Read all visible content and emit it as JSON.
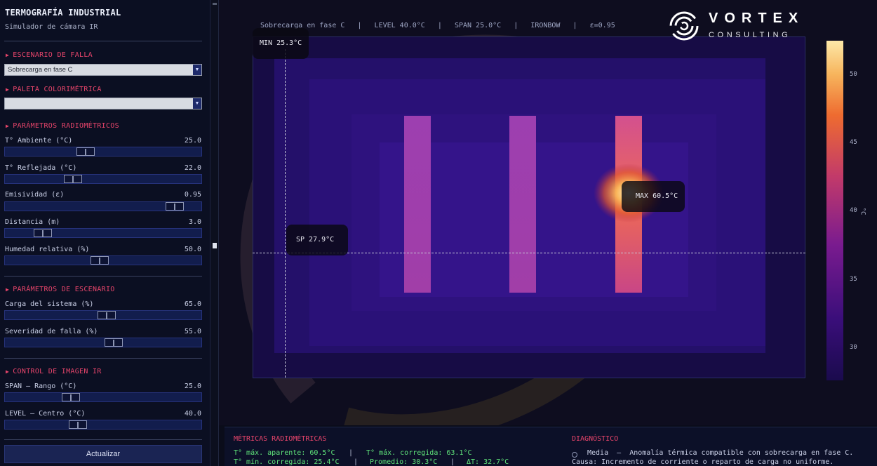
{
  "sidebar": {
    "title": "TERMOGRAFÍA INDUSTRIAL",
    "subtitle": "Simulador de cámara IR",
    "sections": {
      "fault": "ESCENARIO DE FALLA",
      "palette": "PALETA COLORIMÉTRICA",
      "radiometric": "PARÁMETROS RADIOMÉTRICOS",
      "scenario": "PARÁMETROS DE ESCENARIO",
      "image": "CONTROL DE IMAGEN IR"
    },
    "fault_select": {
      "value": "Sobrecarga en fase C"
    },
    "palette_select": {
      "value": ""
    },
    "sliders": [
      {
        "label": "T° Ambiente (°C)",
        "value": "25.0",
        "position": 0.4
      },
      {
        "label": "T° Reflejada (°C)",
        "value": "22.0",
        "position": 0.33
      },
      {
        "label": "Emisividad (ε)",
        "value": "0.95",
        "position": 0.9
      },
      {
        "label": "Distancia (m)",
        "value": "3.0",
        "position": 0.16
      },
      {
        "label": "Humedad relativa (%)",
        "value": "50.0",
        "position": 0.48
      },
      {
        "label": "Carga del sistema (%)",
        "value": "65.0",
        "position": 0.52
      },
      {
        "label": "Severidad de falla (%)",
        "value": "55.0",
        "position": 0.56
      },
      {
        "label": "SPAN – Rango (°C)",
        "value": "25.0",
        "position": 0.32
      },
      {
        "label": "LEVEL – Centro (°C)",
        "value": "40.0",
        "position": 0.36
      }
    ],
    "update_button": "Actualizar"
  },
  "viewer": {
    "hud": "Sobrecarga en fase C   |   LEVEL 40.0°C   |   SPAN 25.0°C   |   IRONBOW   |   ε=0.95",
    "min_tag": "MIN  25.3°C",
    "max_tag": "MAX  60.5°C",
    "spot_tag": "SP  27.9°C",
    "colorbar": {
      "ticks": [
        "50",
        "45",
        "40",
        "35",
        "30"
      ],
      "unit": "°C"
    }
  },
  "logo": {
    "line1": "VORTEX",
    "line2": "CONSULTING"
  },
  "metrics": {
    "title": "MÉTRICAS RADIOMÉTRICAS",
    "tmax_apparent": "T° máx. aparente: 60.5°C",
    "tmax_corrected": "T° máx. corregida: 63.1°C",
    "tmin_corrected": "T° mín. corregida: 25.4°C",
    "mean": "Promedio: 30.3°C",
    "delta": "ΔT: 32.7°C"
  },
  "diagnosis": {
    "title": "DIAGNÓSTICO",
    "line1": "Media  –  Anomalía térmica compatible con sobrecarga en fase C.",
    "line2": "Causa: Incremento de corriente o reparto de carga no uniforme."
  },
  "colors": {
    "accent": "#e8456b",
    "metric_green": "#5fe37a",
    "panel": "#0b0f22"
  }
}
